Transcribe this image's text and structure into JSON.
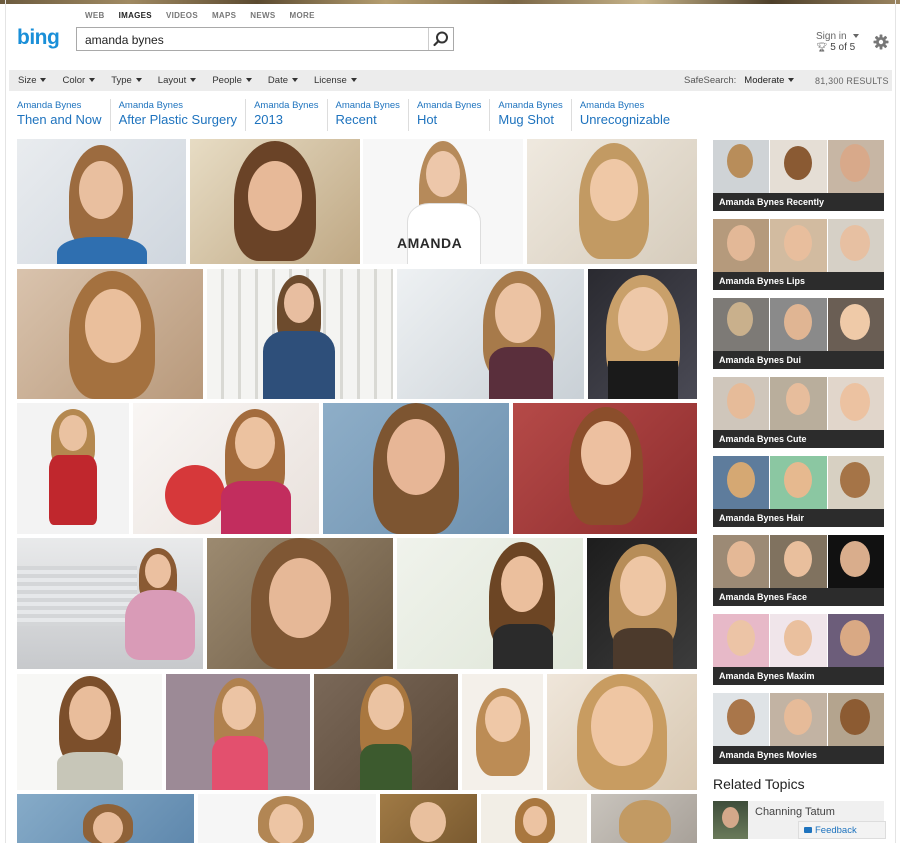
{
  "nav": {
    "items": [
      "WEB",
      "IMAGES",
      "VIDEOS",
      "MAPS",
      "NEWS",
      "MORE"
    ],
    "active": "IMAGES"
  },
  "logo": "bing",
  "search": {
    "value": "amanda bynes"
  },
  "account": {
    "signin": "Sign in",
    "rewards": "5 of 5"
  },
  "filters": [
    "Size",
    "Color",
    "Type",
    "Layout",
    "People",
    "Date",
    "License"
  ],
  "safesearch": {
    "label": "SafeSearch:",
    "value": "Moderate"
  },
  "result_count": "81,300 RESULTS",
  "pivots": [
    {
      "line1": "Amanda Bynes",
      "line2": "Then and Now"
    },
    {
      "line1": "Amanda Bynes",
      "line2": "After Plastic Surgery"
    },
    {
      "line1": "Amanda Bynes",
      "line2": "2013"
    },
    {
      "line1": "Amanda Bynes",
      "line2": "Recent"
    },
    {
      "line1": "Amanda Bynes",
      "line2": "Hot"
    },
    {
      "line1": "Amanda Bynes",
      "line2": "Mug Shot"
    },
    {
      "line1": "Amanda Bynes",
      "line2": "Unrecognizable"
    }
  ],
  "image_caption": "AMANDA",
  "related_searches": [
    "Amanda Bynes Recently",
    "Amanda Bynes Lips",
    "Amanda Bynes Dui",
    "Amanda Bynes Cute",
    "Amanda Bynes Hair",
    "Amanda Bynes Face",
    "Amanda Bynes Maxim",
    "Amanda Bynes Movies"
  ],
  "related_topics": {
    "heading": "Related Topics",
    "items": [
      "Channing Tatum"
    ]
  },
  "feedback": "Feedback",
  "colors": {
    "accent": "#1e73be",
    "logo": "#1a8fd8",
    "filterbar": "#ececec",
    "label_bar": "#2c2c2c"
  }
}
